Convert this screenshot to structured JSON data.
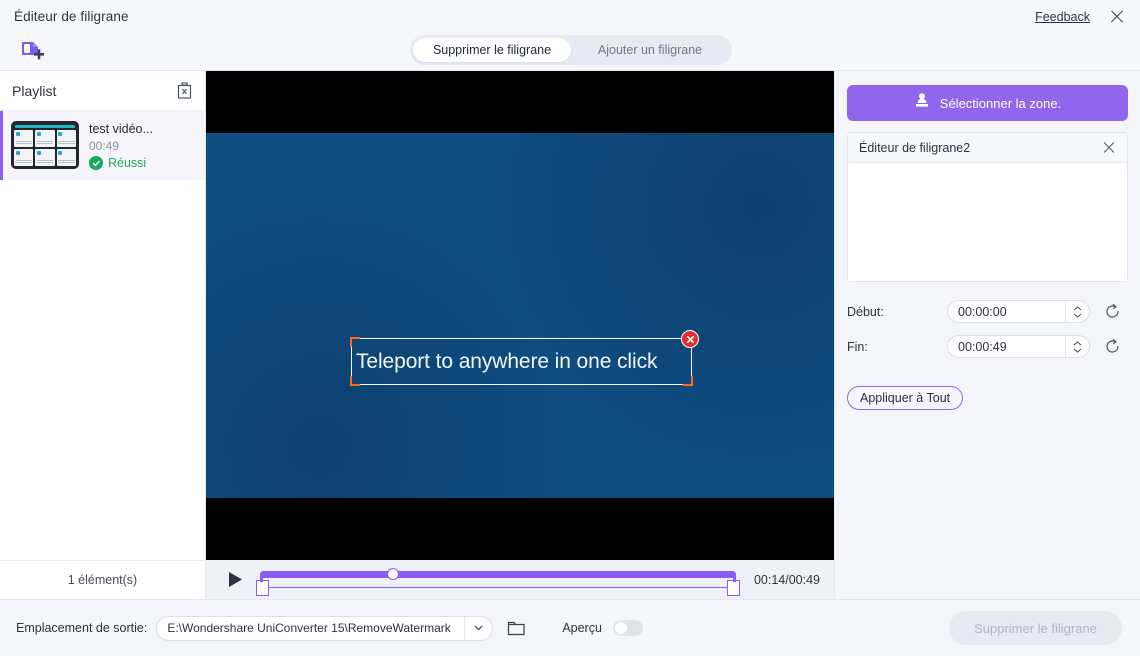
{
  "window": {
    "title": "Éditeur de filigrane",
    "feedback_label": "Feedback",
    "close_icon": "close-icon"
  },
  "toolbar": {
    "add_file_icon": "add-file-icon",
    "tabs": [
      {
        "label": "Supprimer le filigrane",
        "active": true
      },
      {
        "label": "Ajouter un filigrane",
        "active": false
      }
    ]
  },
  "playlist": {
    "title": "Playlist",
    "delete_icon": "trash-icon",
    "items": [
      {
        "name": "test vidéo...",
        "duration": "00:49",
        "status": "Réussi",
        "status_icon": "check-circle-icon",
        "thumbnail": "video-thumbnail"
      }
    ],
    "footer_count": "1 élément(s)"
  },
  "player": {
    "watermark": {
      "text": "Teleport to anywhere in one click",
      "close_icon": "remove-selection-icon"
    },
    "play_icon": "play-icon",
    "time_display": "00:14/00:49",
    "progress_percent": 28,
    "video_background_color": "#0f4c81",
    "letterbox_color": "#000000"
  },
  "right_panel": {
    "select_zone": {
      "label": "Sélectionner la zone.",
      "icon": "stamp-icon",
      "color": "#9166ec"
    },
    "watermark_card": {
      "title": "Éditeur de filigrane2",
      "close_icon": "close-icon"
    },
    "fields": [
      {
        "label": "Début:",
        "value": "00:00:00",
        "reset_icon": "reset-icon"
      },
      {
        "label": "Fin:",
        "value": "00:00:49",
        "reset_icon": "reset-icon"
      }
    ],
    "apply_all_label": "Appliquer à Tout"
  },
  "bottom_bar": {
    "output_label": "Emplacement de sortie:",
    "output_path": "E:\\Wondershare UniConverter 15\\RemoveWatermark",
    "dropdown_icon": "chevron-down-icon",
    "folder_icon": "folder-icon",
    "preview_label": "Aperçu",
    "preview_enabled": false,
    "primary_button_label": "Supprimer le filigrane",
    "primary_button_enabled": false
  }
}
